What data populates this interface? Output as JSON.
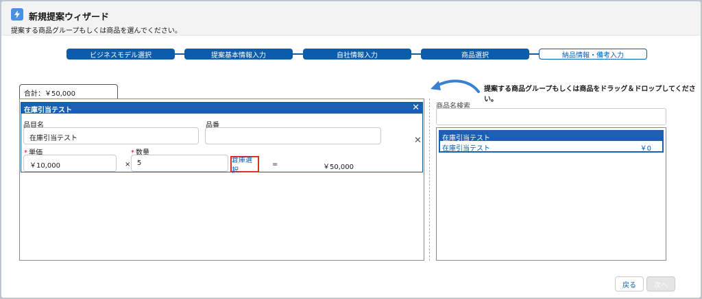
{
  "header": {
    "icon": "bolt-icon",
    "title": "新規提案ウィザード",
    "subtitle": "提案する商品グループもしくは商品を選んでください。"
  },
  "steps": [
    {
      "label": "ビジネスモデル選択",
      "active": true
    },
    {
      "label": "提案基本情報入力",
      "active": true
    },
    {
      "label": "自社情報入力",
      "active": true
    },
    {
      "label": "商品選択",
      "active": true
    },
    {
      "label": "納品情報・備考入力",
      "active": false
    }
  ],
  "left": {
    "total_tab": "合計：￥50,000",
    "card": {
      "title": "在庫引当テスト",
      "item_name_label": "品目名",
      "item_name_value": "在庫引当テスト",
      "part_no_label": "品番",
      "part_no_value": "",
      "unit_price_label": "単価",
      "unit_price_value": "￥10,000",
      "times": "×",
      "qty_label": "数量",
      "qty_value": "5",
      "stock_button": "倉庫選択",
      "equals": "=",
      "subtotal": "￥50,000"
    }
  },
  "right": {
    "drag_hint": "提案する商品グループもしくは商品をドラッグ＆ドロップしてください。",
    "search_label": "商品名検索",
    "search_value": "",
    "group": {
      "title": "在庫引当テスト",
      "item_name": "在庫引当テスト",
      "item_price": "￥0"
    }
  },
  "footer": {
    "back": "戻る",
    "next": "次へ"
  },
  "colors": {
    "accent": "#0b5cab",
    "header_bar": "#1b5fb2",
    "highlight": "#d93025",
    "required": "#ea001e"
  }
}
